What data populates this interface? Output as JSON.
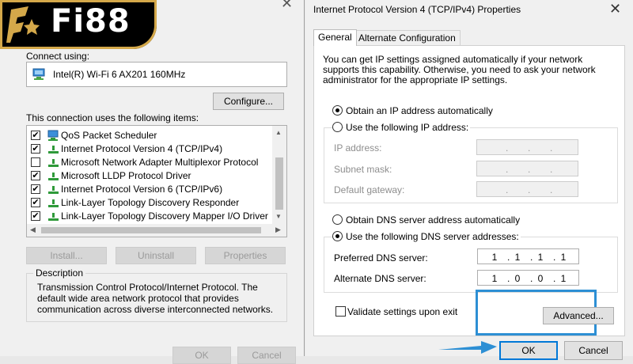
{
  "logo": {
    "text": "Fi88",
    "brand_color": "#d4a84a"
  },
  "left_dialog": {
    "connect_using_label": "Connect using:",
    "adapter_name": "Intel(R) Wi-Fi 6 AX201 160MHz",
    "configure_label": "Configure...",
    "items_label": "This connection uses the following items:",
    "items": [
      {
        "label": "QoS Packet Scheduler",
        "checked": true,
        "icon": "network-scheduler-icon"
      },
      {
        "label": "Internet Protocol Version 4 (TCP/IPv4)",
        "checked": true,
        "icon": "protocol-icon"
      },
      {
        "label": "Microsoft Network Adapter Multiplexor Protocol",
        "checked": false,
        "icon": "protocol-icon"
      },
      {
        "label": "Microsoft LLDP Protocol Driver",
        "checked": true,
        "icon": "protocol-icon"
      },
      {
        "label": "Internet Protocol Version 6 (TCP/IPv6)",
        "checked": true,
        "icon": "protocol-icon"
      },
      {
        "label": "Link-Layer Topology Discovery Responder",
        "checked": true,
        "icon": "protocol-icon"
      },
      {
        "label": "Link-Layer Topology Discovery Mapper I/O Driver",
        "checked": true,
        "icon": "protocol-icon"
      }
    ],
    "install_label": "Install...",
    "uninstall_label": "Uninstall",
    "properties_label": "Properties",
    "description_title": "Description",
    "description_text": "Transmission Control Protocol/Internet Protocol. The default wide area network protocol that provides communication across diverse interconnected networks.",
    "ok_label": "OK",
    "cancel_label": "Cancel"
  },
  "right_dialog": {
    "title": "Internet Protocol Version 4 (TCP/IPv4) Properties",
    "tabs": [
      "General",
      "Alternate Configuration"
    ],
    "intro_text": "You can get IP settings assigned automatically if your network supports this capability. Otherwise, you need to ask your network administrator for the appropriate IP settings.",
    "obtain_ip_auto": "Obtain an IP address automatically",
    "use_following_ip": "Use the following IP address:",
    "ip_address_label": "IP address:",
    "subnet_mask_label": "Subnet mask:",
    "default_gateway_label": "Default gateway:",
    "obtain_dns_auto": "Obtain DNS server address automatically",
    "use_following_dns": "Use the following DNS server addresses:",
    "preferred_dns_label": "Preferred DNS server:",
    "alternate_dns_label": "Alternate DNS server:",
    "preferred_dns": [
      "1",
      "1",
      "1",
      "1"
    ],
    "alternate_dns": [
      "1",
      "0",
      "0",
      "1"
    ],
    "validate_label": "Validate settings upon exit",
    "advanced_label": "Advanced...",
    "ok_label": "OK",
    "cancel_label": "Cancel",
    "highlight_color": "#2d8fd4"
  }
}
